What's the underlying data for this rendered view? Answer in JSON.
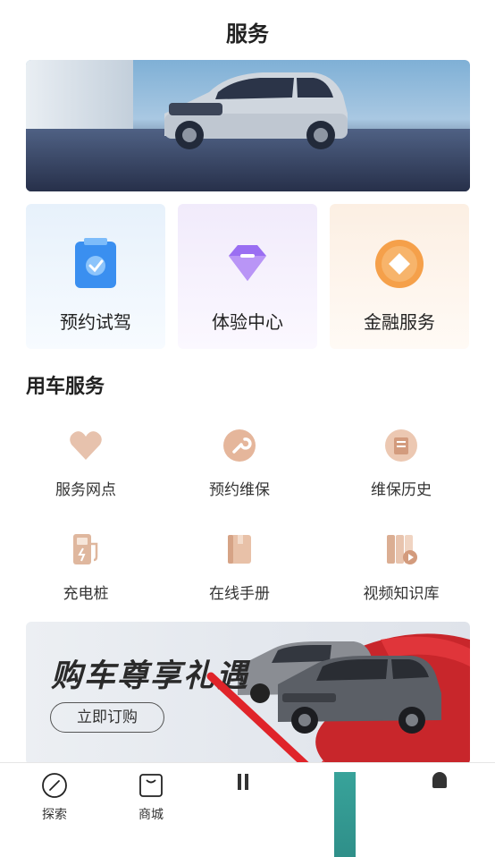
{
  "header": {
    "title": "服务"
  },
  "quick_actions": [
    {
      "label": "预约试驾",
      "icon": "clipboard-check-icon"
    },
    {
      "label": "体验中心",
      "icon": "diamond-icon"
    },
    {
      "label": "金融服务",
      "icon": "coin-icon"
    }
  ],
  "car_service": {
    "title": "用车服务",
    "items": [
      {
        "label": "服务网点",
        "icon": "heart-icon"
      },
      {
        "label": "预约维保",
        "icon": "wrench-icon"
      },
      {
        "label": "维保历史",
        "icon": "history-icon"
      },
      {
        "label": "充电桩",
        "icon": "charging-station-icon"
      },
      {
        "label": "在线手册",
        "icon": "manual-icon"
      },
      {
        "label": "视频知识库",
        "icon": "video-library-icon"
      }
    ]
  },
  "promo": {
    "headline": "购车尊享礼遇",
    "cta": "立即订购"
  },
  "tabbar": {
    "items": [
      {
        "label": "探索",
        "icon": "compass-icon"
      },
      {
        "label": "商城",
        "icon": "shopping-bag-icon"
      }
    ]
  },
  "colors": {
    "accent_blue": "#3a8ff0",
    "accent_purple": "#9a6ef2",
    "accent_orange": "#f5a04a",
    "service_tan": "#d9a989"
  }
}
